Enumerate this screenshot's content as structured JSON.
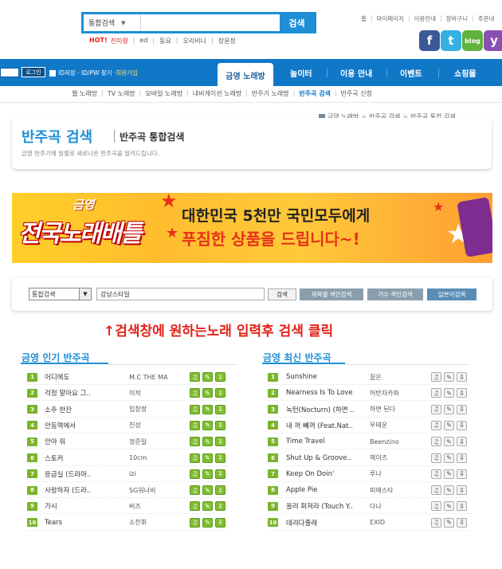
{
  "header": {
    "search_select": "통합검색",
    "search_button": "검색",
    "hot_label": "HOT!",
    "hot_keywords": [
      "진미령",
      "ed",
      "동요",
      "오리비니",
      "장윤정"
    ],
    "util_links": [
      "홈",
      "마이페이지",
      "이용안내",
      "장바구니",
      "주문내"
    ],
    "sns": [
      {
        "name": "facebook",
        "glyph": "f",
        "color": "#3b5998"
      },
      {
        "name": "twitter",
        "glyph": "t",
        "color": "#33b1e2"
      },
      {
        "name": "blog",
        "glyph": "blog",
        "color": "#61b23c"
      },
      {
        "name": "yozm",
        "glyph": "y",
        "color": "#8a4fb0"
      }
    ]
  },
  "login": {
    "button": "로그인",
    "save_id": "ID저장 · ID/PW 찾기 · ",
    "join": "회원가입"
  },
  "nav": {
    "active": "금영 노래방",
    "items": [
      "놀이터",
      "이용 안내",
      "이벤트",
      "쇼핑몰"
    ]
  },
  "subnav": [
    "웹 노래방",
    "TV 노래방",
    "모바일 노래방",
    "내비게이션 노래방",
    "반주기 노래방",
    "반주곡 검색",
    "반주곡 신청"
  ],
  "subnav_current": "반주곡 검색",
  "breadcrumb": [
    "금영 노래방",
    "반주곡 검색",
    "반주곡 통합 검색"
  ],
  "page": {
    "title": "반주곡 검색",
    "subtitle": "반주곡 통합검색",
    "desc": "금영 반주기에 월별로 새로나온 반주곡을 알려드립니다."
  },
  "banner": {
    "logo_top": "금영",
    "logo_main": "전국노래배틀",
    "line1": "대한민국 5천만 국민모두에게",
    "line2": "푸짐한 상품을 드립니다~!"
  },
  "search": {
    "select": "통합검색",
    "value": "강남스타일",
    "button": "검색",
    "title_index": "제목별 색인검색",
    "singer_index": "가수 색인검색",
    "japanese": "일본어검색"
  },
  "hint": "↑검색창에 원하는노래 입력후 검색 클릭",
  "popular": {
    "title": "금영 인기 반주곡",
    "rows": [
      {
        "rank": "1",
        "song": "어디에도",
        "artist": "M.C THE MA"
      },
      {
        "rank": "2",
        "song": "걱정 말아요 그..",
        "artist": "이적"
      },
      {
        "rank": "3",
        "song": "소주 한잔",
        "artist": "임창정"
      },
      {
        "rank": "4",
        "song": "안동역에서",
        "artist": "진성"
      },
      {
        "rank": "5",
        "song": "안아 줘",
        "artist": "정준일"
      },
      {
        "rank": "6",
        "song": "스토커",
        "artist": "10cm"
      },
      {
        "rank": "7",
        "song": "응급실 (드라마..",
        "artist": "izi"
      },
      {
        "rank": "8",
        "song": "사랑하자 (드라..",
        "artist": "SG워너비"
      },
      {
        "rank": "9",
        "song": "가시",
        "artist": "버즈"
      },
      {
        "rank": "10",
        "song": "Tears",
        "artist": "소찬휘"
      }
    ]
  },
  "latest": {
    "title": "금영 최신 반주곡",
    "rows": [
      {
        "rank": "1",
        "song": "Sunshine",
        "artist": "짙은"
      },
      {
        "rank": "2",
        "song": "Nearness Is To Love",
        "artist": "어반자카파"
      },
      {
        "rank": "3",
        "song": "녹턴(Nocturn) (하면 ..",
        "artist": "하면 된다"
      },
      {
        "rank": "4",
        "song": "내 꺼 빼꺼 (Feat.Nat..",
        "artist": "우태운"
      },
      {
        "rank": "5",
        "song": "Time Travel",
        "artist": "Beenzino"
      },
      {
        "rank": "6",
        "song": "Shut Up & Groove..",
        "artist": "헤이즈"
      },
      {
        "rank": "7",
        "song": "Keep On Doin'",
        "artist": "루나"
      },
      {
        "rank": "8",
        "song": "Apple Pie",
        "artist": "피에스타"
      },
      {
        "rank": "9",
        "song": "올려 퍼져라 (Touch Y..",
        "artist": "다나"
      },
      {
        "rank": "10",
        "song": "데려다줄래",
        "artist": "EXID"
      }
    ]
  },
  "colors": {
    "accent": "#1e8fd6",
    "nav": "#1178c8",
    "rank": "#7cb32c",
    "hint": "#e2231a"
  }
}
